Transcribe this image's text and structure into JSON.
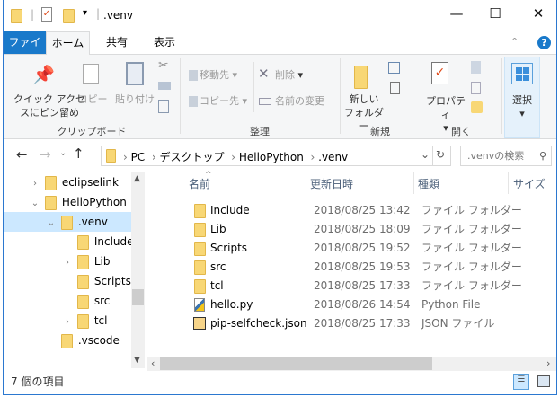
{
  "window": {
    "title": ".venv",
    "minimize": "—",
    "maximize": "☐",
    "close": "✕"
  },
  "tabs": [
    {
      "label": "ファイル"
    },
    {
      "label": "ホーム"
    },
    {
      "label": "共有"
    },
    {
      "label": "表示"
    }
  ],
  "ribbon": {
    "clipboard": {
      "label": "クリップボード",
      "pin": "クイック アクセ",
      "pin2": "スにピン留め",
      "copy": "コピー",
      "paste": "貼り付け"
    },
    "organize": {
      "label": "整理",
      "move": "移動先",
      "copyto": "コピー先",
      "delete": "削除",
      "rename": "名前の変更"
    },
    "new": {
      "label": "新規",
      "new_folder": "新しい",
      "new_folder2": "フォルダー"
    },
    "open": {
      "label": "開く",
      "properties": "プロパティ"
    },
    "select": {
      "label": "選択"
    }
  },
  "address": {
    "crumbs": [
      "PC",
      "デスクトップ",
      "HelloPython",
      ".venv"
    ],
    "search_placeholder": ".venvの検索"
  },
  "nav": [
    {
      "label": "eclipselink",
      "depth": 0,
      "chev": "›"
    },
    {
      "label": "HelloPython",
      "depth": 0,
      "chev": "⌄"
    },
    {
      "label": ".venv",
      "depth": 1,
      "chev": "⌄",
      "selected": true
    },
    {
      "label": "Include",
      "depth": 2,
      "chev": ""
    },
    {
      "label": "Lib",
      "depth": 2,
      "chev": "›"
    },
    {
      "label": "Scripts",
      "depth": 2,
      "chev": ""
    },
    {
      "label": "src",
      "depth": 2,
      "chev": ""
    },
    {
      "label": "tcl",
      "depth": 2,
      "chev": "›"
    },
    {
      "label": ".vscode",
      "depth": 1,
      "chev": ""
    }
  ],
  "columns": {
    "name": "名前",
    "date": "更新日時",
    "type": "種類",
    "size": "サイズ"
  },
  "files": [
    {
      "name": "Include",
      "date": "2018/08/25 13:42",
      "type": "ファイル フォルダー",
      "icon": "folder"
    },
    {
      "name": "Lib",
      "date": "2018/08/25 18:09",
      "type": "ファイル フォルダー",
      "icon": "folder"
    },
    {
      "name": "Scripts",
      "date": "2018/08/25 19:52",
      "type": "ファイル フォルダー",
      "icon": "folder"
    },
    {
      "name": "src",
      "date": "2018/08/25 19:53",
      "type": "ファイル フォルダー",
      "icon": "folder"
    },
    {
      "name": "tcl",
      "date": "2018/08/25 17:33",
      "type": "ファイル フォルダー",
      "icon": "folder"
    },
    {
      "name": "hello.py",
      "date": "2018/08/26 14:54",
      "type": "Python File",
      "icon": "python-file"
    },
    {
      "name": "pip-selfcheck.json",
      "date": "2018/08/25 17:33",
      "type": "JSON ファイル",
      "icon": "json-file"
    }
  ],
  "status": {
    "count": "7 個の項目"
  },
  "colors": {
    "accent": "#1979ca",
    "selection": "#cce8ff"
  }
}
